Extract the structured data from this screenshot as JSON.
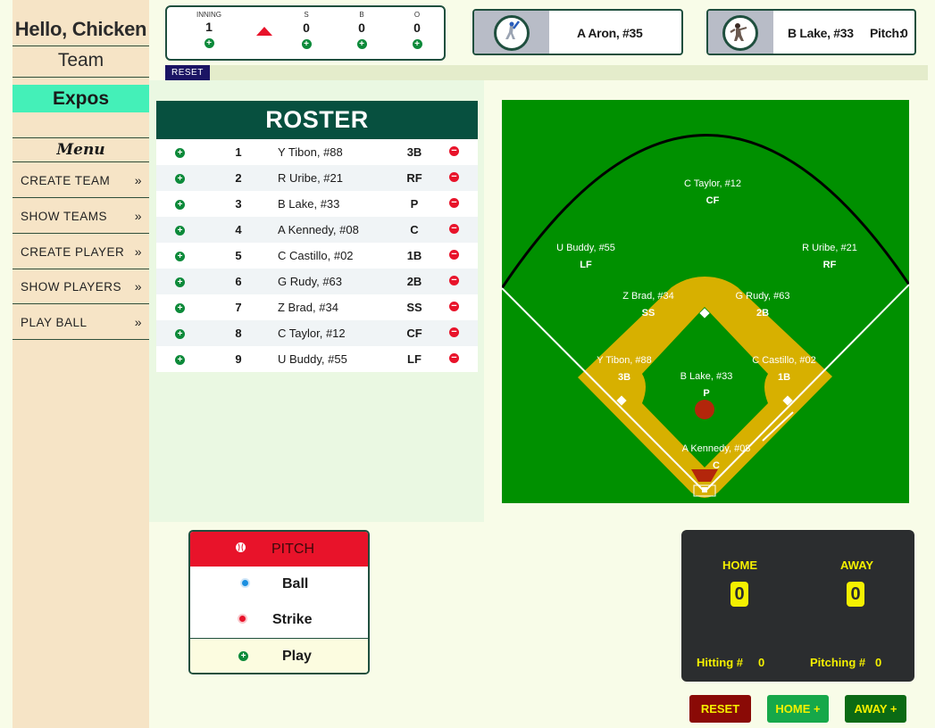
{
  "sidebar": {
    "greeting": "Hello, Chicken",
    "team_link": "Team",
    "team_name": "Expos",
    "menu_title": "Menu",
    "items": [
      {
        "label": "CREATE TEAM"
      },
      {
        "label": "SHOW TEAMS"
      },
      {
        "label": "CREATE PLAYER"
      },
      {
        "label": "SHOW PLAYERS"
      },
      {
        "label": "PLAY BALL"
      }
    ],
    "chevron": "»"
  },
  "count": {
    "inning_label": "INNING",
    "inning": "1",
    "s_label": "S",
    "s": "0",
    "b_label": "B",
    "b": "0",
    "o_label": "O",
    "o": "0",
    "half": "top"
  },
  "reset_small": "RESET",
  "batter": {
    "name": "A Aron, #35",
    "icon": "batter-icon"
  },
  "pitcher": {
    "name": "B Lake, #33",
    "pitch_label": "Pitch:",
    "pitch_count": "0",
    "icon": "pitcher-icon"
  },
  "roster": {
    "title": "ROSTER",
    "rows": [
      {
        "order": "1",
        "name": "Y Tibon, #88",
        "pos": "3B"
      },
      {
        "order": "2",
        "name": "R Uribe, #21",
        "pos": "RF"
      },
      {
        "order": "3",
        "name": "B Lake, #33",
        "pos": "P"
      },
      {
        "order": "4",
        "name": "A Kennedy, #08",
        "pos": "C"
      },
      {
        "order": "5",
        "name": "C Castillo, #02",
        "pos": "1B"
      },
      {
        "order": "6",
        "name": "G Rudy, #63",
        "pos": "2B"
      },
      {
        "order": "7",
        "name": "Z Brad, #34",
        "pos": "SS"
      },
      {
        "order": "8",
        "name": "C Taylor, #12",
        "pos": "CF"
      },
      {
        "order": "9",
        "name": "U Buddy, #55",
        "pos": "LF"
      }
    ]
  },
  "field": {
    "positions": [
      {
        "name": "C Taylor, #12",
        "pos": "CF"
      },
      {
        "name": "U Buddy, #55",
        "pos": "LF"
      },
      {
        "name": "R Uribe, #21",
        "pos": "RF"
      },
      {
        "name": "Z Brad, #34",
        "pos": "SS"
      },
      {
        "name": "G Rudy, #63",
        "pos": "2B"
      },
      {
        "name": "Y Tibon, #88",
        "pos": "3B"
      },
      {
        "name": "C Castillo, #02",
        "pos": "1B"
      },
      {
        "name": "B Lake, #33",
        "pos": "P"
      },
      {
        "name": "A Kennedy, #08",
        "pos": "C"
      }
    ],
    "colors": {
      "grass": "#009000",
      "dirt": "#d7b000",
      "mound": "#b3260b",
      "lines": "#ffffff"
    }
  },
  "pitch_panel": {
    "pitch": "PITCH",
    "ball": "Ball",
    "strike": "Strike",
    "play": "Play"
  },
  "score": {
    "home_label": "HOME",
    "home": "0",
    "away_label": "AWAY",
    "away": "0",
    "hitting_label": "Hitting #",
    "hitting": "0",
    "pitching_label": "Pitching #",
    "pitching": "0"
  },
  "buttons": {
    "reset": "RESET",
    "home_plus": "HOME +",
    "away_plus": "AWAY +"
  },
  "colors": {
    "accent_green": "#07503f",
    "team_highlight": "#44f0b8",
    "alert_red": "#e8132a",
    "score_yellow": "#f4f000"
  }
}
